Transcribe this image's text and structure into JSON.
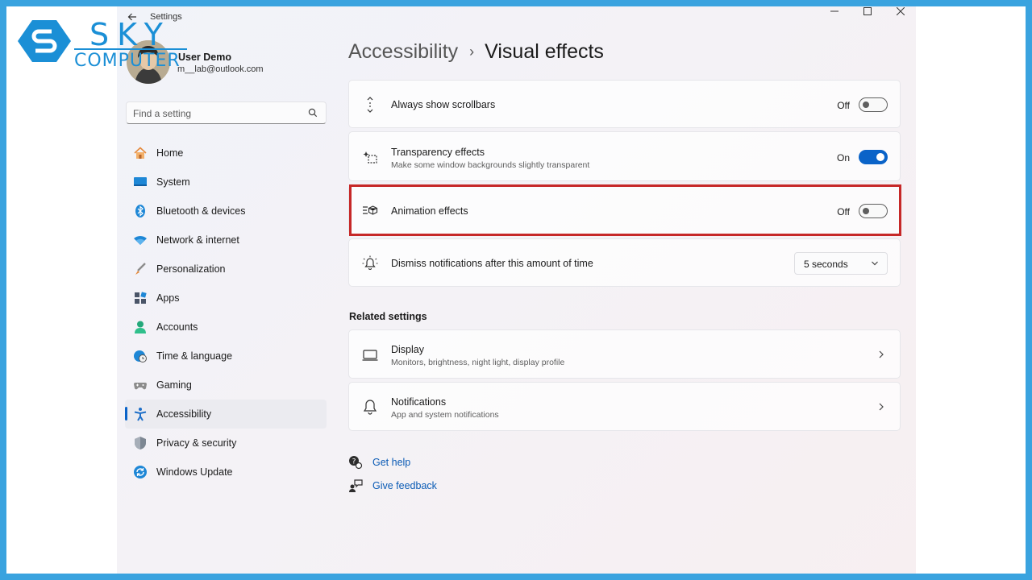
{
  "logo": {
    "line1": "SKY",
    "line2": "COMPUTER"
  },
  "titlebar": {
    "app_title": "Settings"
  },
  "user": {
    "name": "User Demo",
    "email": "m__lab@outlook.com"
  },
  "search": {
    "placeholder": "Find a setting"
  },
  "nav": {
    "items": [
      {
        "label": "Home",
        "icon": "home-icon"
      },
      {
        "label": "System",
        "icon": "system-icon"
      },
      {
        "label": "Bluetooth & devices",
        "icon": "bluetooth-icon"
      },
      {
        "label": "Network & internet",
        "icon": "wifi-icon"
      },
      {
        "label": "Personalization",
        "icon": "brush-icon"
      },
      {
        "label": "Apps",
        "icon": "apps-icon"
      },
      {
        "label": "Accounts",
        "icon": "account-icon"
      },
      {
        "label": "Time & language",
        "icon": "globe-clock-icon"
      },
      {
        "label": "Gaming",
        "icon": "gamepad-icon"
      },
      {
        "label": "Accessibility",
        "icon": "accessibility-icon",
        "active": true
      },
      {
        "label": "Privacy & security",
        "icon": "shield-icon"
      },
      {
        "label": "Windows Update",
        "icon": "update-icon"
      }
    ]
  },
  "breadcrumb": {
    "parent": "Accessibility",
    "separator": "›",
    "current": "Visual effects"
  },
  "settings": {
    "scrollbars": {
      "title": "Always show scrollbars",
      "state": "Off"
    },
    "transparency": {
      "title": "Transparency effects",
      "subtitle": "Make some window backgrounds slightly transparent",
      "state": "On"
    },
    "animation": {
      "title": "Animation effects",
      "state": "Off"
    },
    "notifications": {
      "title": "Dismiss notifications after this amount of time",
      "value": "5 seconds"
    }
  },
  "related": {
    "heading": "Related settings",
    "display": {
      "title": "Display",
      "subtitle": "Monitors, brightness, night light, display profile"
    },
    "notifications": {
      "title": "Notifications",
      "subtitle": "App and system notifications"
    }
  },
  "help": {
    "get_help": "Get help",
    "give_feedback": "Give feedback"
  },
  "colors": {
    "accent": "#0a63c8",
    "highlight": "#c62828",
    "frame": "#3aa3df"
  }
}
